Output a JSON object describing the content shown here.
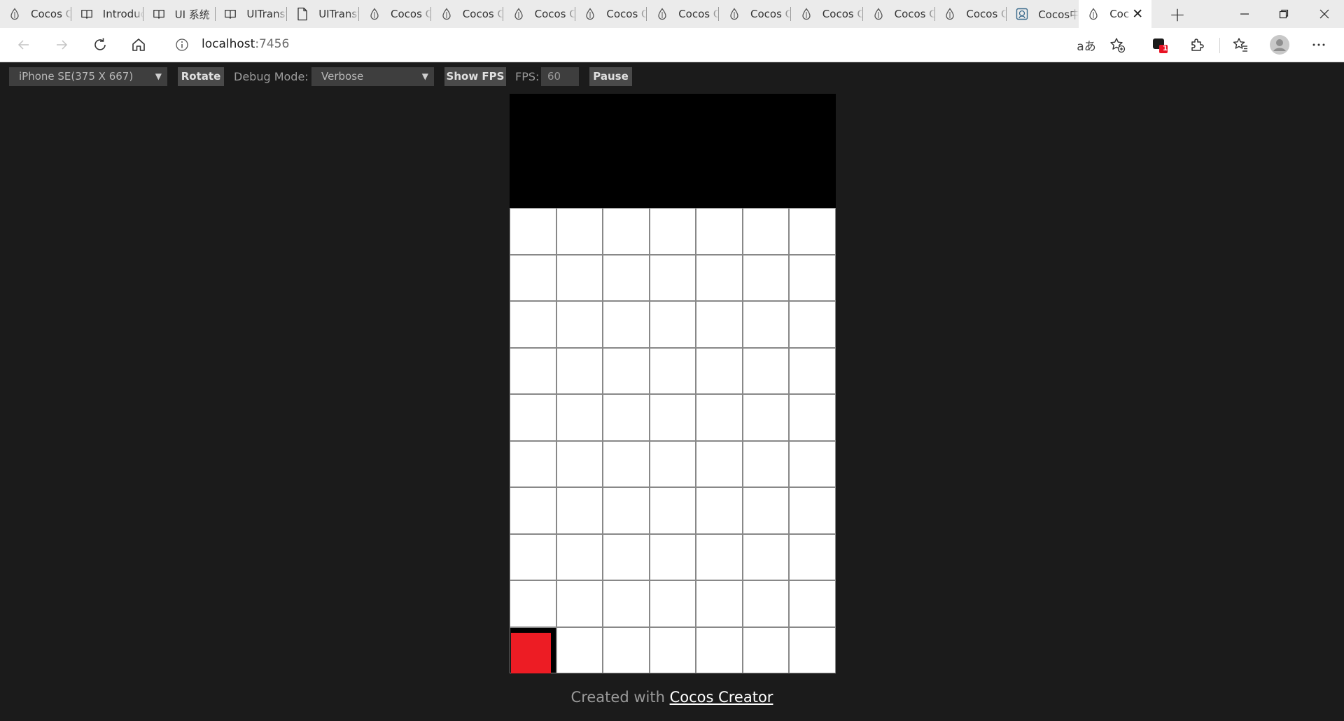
{
  "browser": {
    "tabs": [
      {
        "title": "Cocos Cr",
        "icon": "cocos-icon"
      },
      {
        "title": "Introduc",
        "icon": "book-icon"
      },
      {
        "title": "UI 系统",
        "icon": "book-icon"
      },
      {
        "title": "UITransfo",
        "icon": "book-icon"
      },
      {
        "title": "UITransfo",
        "icon": "document-icon"
      },
      {
        "title": "Cocos C",
        "icon": "cocos-icon"
      },
      {
        "title": "Cocos C",
        "icon": "cocos-icon"
      },
      {
        "title": "Cocos C",
        "icon": "cocos-icon"
      },
      {
        "title": "Cocos C",
        "icon": "cocos-icon"
      },
      {
        "title": "Cocos C",
        "icon": "cocos-icon"
      },
      {
        "title": "Cocos C",
        "icon": "cocos-icon"
      },
      {
        "title": "Cocos C",
        "icon": "cocos-icon"
      },
      {
        "title": "Cocos C",
        "icon": "cocos-icon"
      },
      {
        "title": "Cocos C",
        "icon": "cocos-icon"
      },
      {
        "title": "Cocos中",
        "icon": "cocos-forum-icon"
      },
      {
        "title": "Coc",
        "icon": "cocos-icon",
        "active": true
      }
    ],
    "address": {
      "host": "localhost",
      "port": ":7456"
    },
    "notification_badge": "1"
  },
  "cocos_toolbar": {
    "device_select": "iPhone SE(375 X 667)",
    "rotate_label": "Rotate",
    "debug_mode_label": "Debug Mode:",
    "debug_mode_value": "Verbose",
    "show_fps_label": "Show FPS",
    "fps_label": "FPS:",
    "fps_value": "60",
    "pause_label": "Pause"
  },
  "game": {
    "grid_columns": 7,
    "grid_rows": 10,
    "piece": {
      "column": 1,
      "row": 10,
      "color": "#ed1c24"
    }
  },
  "footer": {
    "prefix": "Created with ",
    "link_text": "Cocos Creator"
  }
}
